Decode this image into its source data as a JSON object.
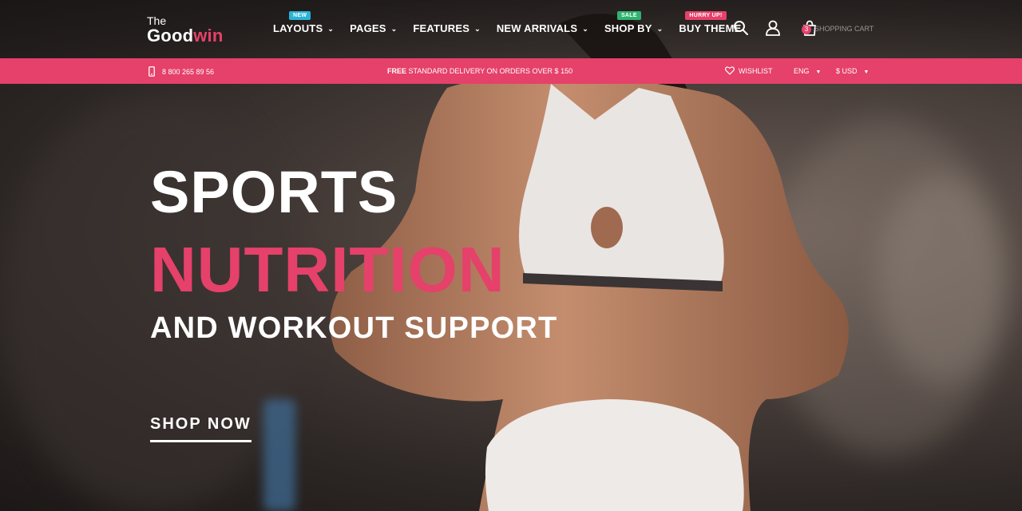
{
  "brand": {
    "small": "The",
    "big_part1": "Good",
    "big_part2": "win"
  },
  "nav": [
    {
      "label": "LAYOUTS",
      "badge": "NEW",
      "badge_color": "#2bb3d6"
    },
    {
      "label": "PAGES",
      "badge": "",
      "badge_color": ""
    },
    {
      "label": "FEATURES",
      "badge": "",
      "badge_color": ""
    },
    {
      "label": "NEW ARRIVALS",
      "badge": "",
      "badge_color": ""
    },
    {
      "label": "SHOP BY",
      "badge": "SALE",
      "badge_color": "#2fb36e"
    },
    {
      "label": "BUY THEME",
      "badge": "HURRY UP!",
      "badge_color": "#e5416a"
    }
  ],
  "header": {
    "cart_count": "3",
    "cart_label": "SHOPPING CART"
  },
  "promo": {
    "phone": "8 800 265 89 56",
    "delivery_bold": "FREE",
    "delivery_text": " STANDARD DELIVERY ON ORDERS OVER $ 150",
    "wishlist": "WISHLIST",
    "language": "ENG",
    "currency": "$ USD"
  },
  "hero": {
    "line1": "SPORTS",
    "line2": "NUTRITION",
    "line3": "AND WORKOUT SUPPORT",
    "cta": "SHOP NOW"
  },
  "colors": {
    "accent": "#e5416a",
    "promo_bar": "#e5416a"
  },
  "icons": [
    "search-icon",
    "user-icon",
    "cart-icon",
    "phone-icon",
    "heart-icon"
  ]
}
